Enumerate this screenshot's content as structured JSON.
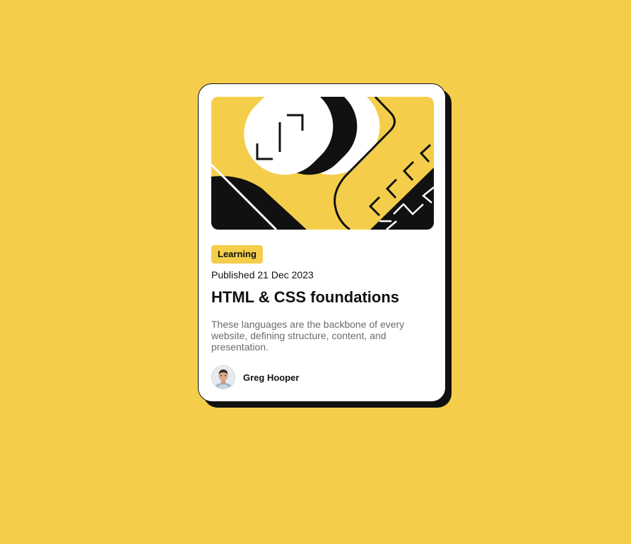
{
  "card": {
    "category_tag": "Learning",
    "published": "Published 21 Dec 2023",
    "title": "HTML & CSS foundations",
    "description": "These languages are the backbone of every website, defining structure, content, and presentation.",
    "author_name": "Greg Hooper"
  },
  "colors": {
    "background": "#f4ce4b",
    "card": "#ffffff",
    "ink": "#111111",
    "muted_text": "#6b6b6b"
  },
  "icons": {
    "illustration": "code-brackets-illustration",
    "avatar": "author-avatar"
  }
}
